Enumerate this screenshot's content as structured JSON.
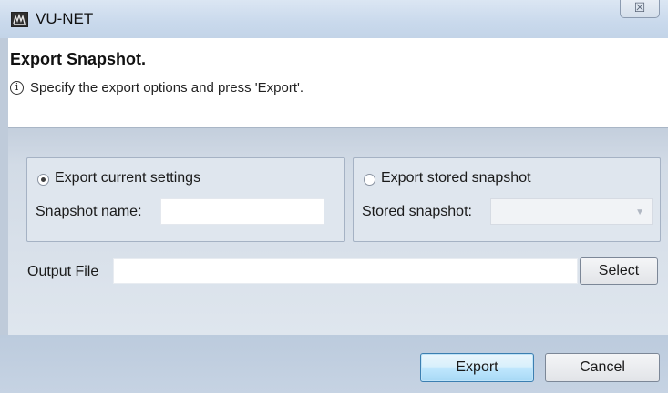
{
  "window": {
    "title": "VU-NET",
    "close_glyph": "☒"
  },
  "header": {
    "title": "Export Snapshot.",
    "info_glyph": "i",
    "message": "Specify the export options and press 'Export'."
  },
  "export_current": {
    "radio_label": "Export current settings",
    "selected": true,
    "name_label": "Snapshot name:",
    "name_value": ""
  },
  "export_stored": {
    "radio_label": "Export stored snapshot",
    "selected": false,
    "stored_label": "Stored snapshot:",
    "stored_value": "",
    "arrow_glyph": "▼"
  },
  "output": {
    "label": "Output File",
    "value": "",
    "select_label": "Select"
  },
  "footer": {
    "export_label": "Export",
    "cancel_label": "Cancel"
  },
  "icons": [
    "app-icon",
    "close-icon",
    "info-icon",
    "dropdown-arrow-icon"
  ],
  "colors": {
    "titlebar": "#c9d9ec",
    "content_bg": "#dfe6ee",
    "footer_bg": "#c6d3e3",
    "export_button_border": "#3c7fb1"
  }
}
